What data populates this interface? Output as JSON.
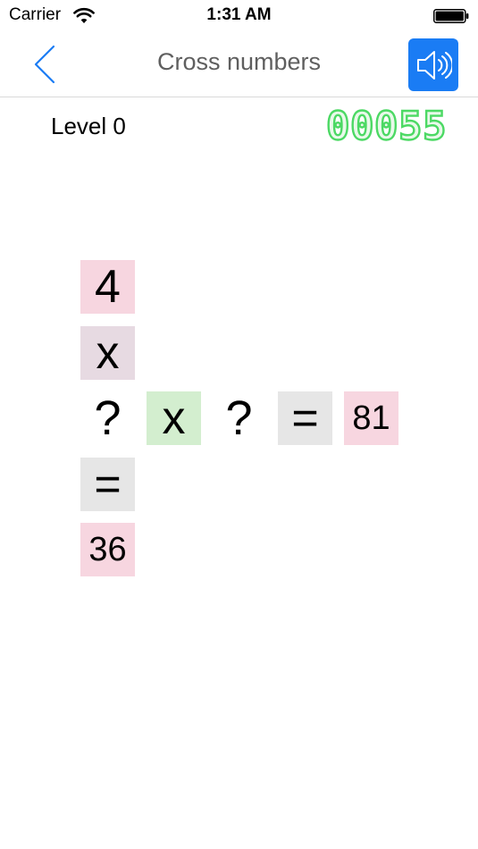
{
  "status_bar": {
    "carrier": "Carrier",
    "time": "1:31 AM"
  },
  "nav": {
    "title": "Cross numbers",
    "back_icon": "chevron-left-icon",
    "sound_icon": "speaker-icon",
    "accent_color": "#1a7cf4"
  },
  "level": {
    "label": "Level 0",
    "score": "00055",
    "score_color": "#4cd964"
  },
  "puzzle": {
    "vertical": {
      "top": "4",
      "operator": "x",
      "equals": "=",
      "result": "36"
    },
    "horizontal": {
      "unknown_a": "?",
      "operator": "x",
      "unknown_b": "?",
      "equals": "=",
      "result": "81"
    }
  }
}
